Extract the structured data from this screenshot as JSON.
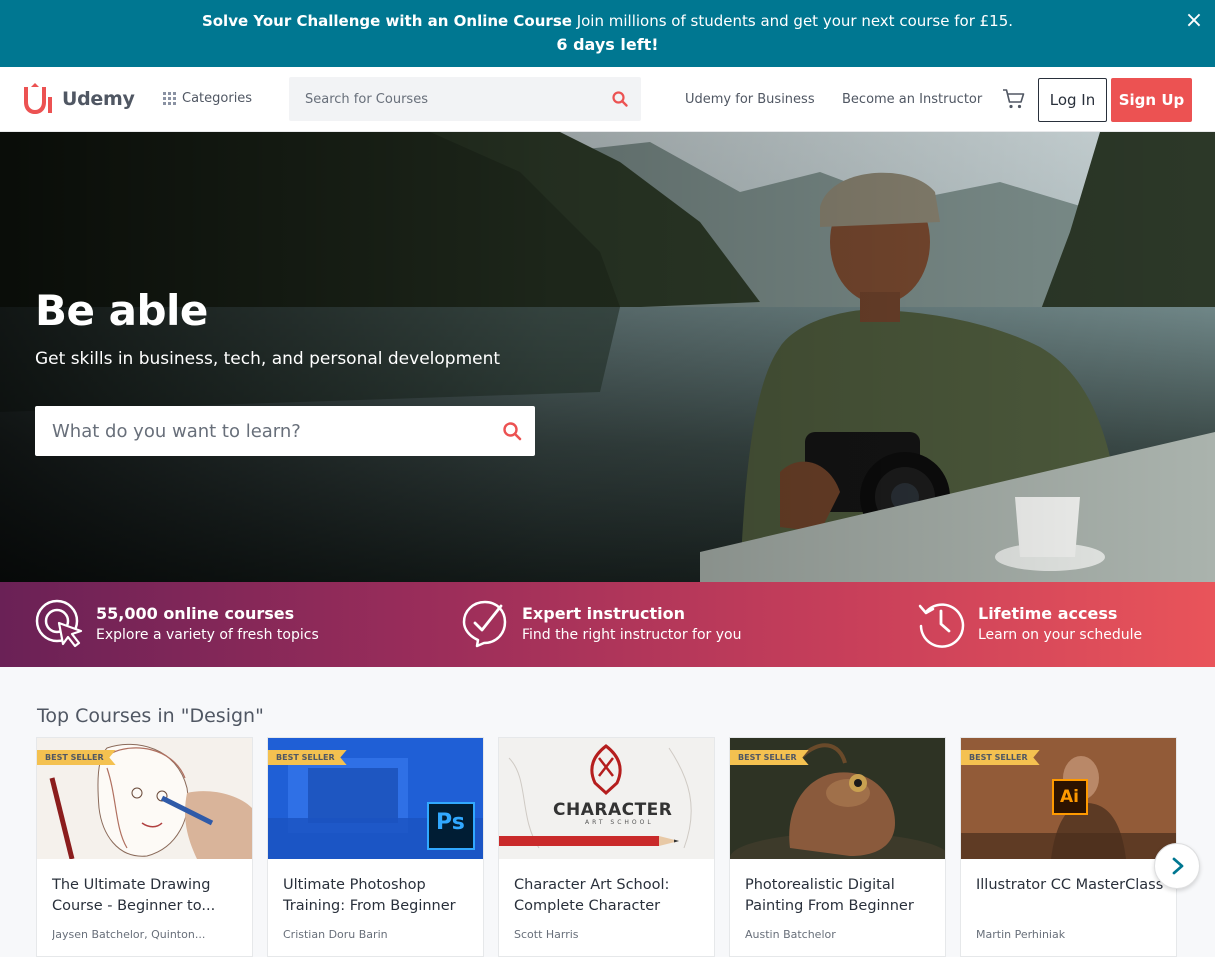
{
  "promo": {
    "headline": "Solve Your Challenge with an Online Course",
    "text": "Join millions of students and get your next course for £15.",
    "countdown": "6 days left!",
    "close_icon": "×"
  },
  "header": {
    "logo_text": "Udemy",
    "categories_label": "Categories",
    "search_placeholder": "Search for Courses",
    "business_link": "Udemy for Business",
    "instructor_link": "Become an Instructor",
    "login_label": "Log In",
    "signup_label": "Sign Up"
  },
  "hero": {
    "title": "Be able",
    "subtitle": "Get skills in business, tech, and personal development",
    "search_placeholder": "What do you want to learn?"
  },
  "value_props": [
    {
      "icon": "target-cursor-icon",
      "title": "55,000 online courses",
      "desc": "Explore a variety of fresh topics"
    },
    {
      "icon": "check-badge-icon",
      "title": "Expert instruction",
      "desc": "Find the right instructor for you"
    },
    {
      "icon": "clock-history-icon",
      "title": "Lifetime access",
      "desc": "Learn on your schedule"
    }
  ],
  "courses_section": {
    "title": "Top Courses in \"Design\"",
    "courses": [
      {
        "title": "The Ultimate Drawing Course - Beginner to...",
        "author": "Jaysen Batchelor, Quinton...",
        "badge": "BEST SELLER"
      },
      {
        "title": "Ultimate Photoshop Training: From Beginner",
        "author": "Cristian Doru Barin",
        "badge": "BEST SELLER",
        "thumb_label": "Ps"
      },
      {
        "title": "Character Art School: Complete Character",
        "author": "Scott Harris",
        "badge": "",
        "thumb_label": "CHARACTER",
        "thumb_sublabel": "ART SCHOOL"
      },
      {
        "title": "Photorealistic Digital Painting From Beginner",
        "author": "Austin Batchelor",
        "badge": "BEST SELLER"
      },
      {
        "title": "Illustrator CC MasterClass",
        "author": "Martin Perhiniak",
        "badge": "BEST SELLER",
        "thumb_label": "Ai"
      }
    ]
  },
  "colors": {
    "promo_bg": "#007791",
    "brand_red": "#ec5252",
    "text_dark": "#29303b",
    "badge_yellow": "#f4c150",
    "ps_blue": "#1f5fd6"
  }
}
